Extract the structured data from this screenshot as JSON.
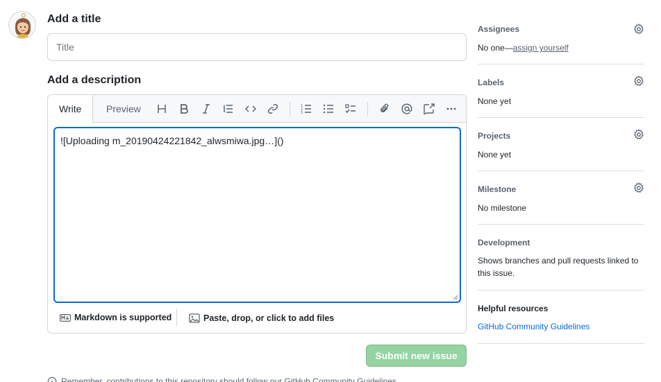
{
  "form": {
    "title_label": "Add a title",
    "title_placeholder": "Title",
    "description_label": "Add a description"
  },
  "editor": {
    "tabs": [
      {
        "label": "Write",
        "active": true
      },
      {
        "label": "Preview",
        "active": false
      }
    ],
    "toolbar_icons": [
      "heading-icon",
      "bold-icon",
      "italic-icon",
      "quote-icon",
      "code-icon",
      "link-icon",
      "ordered-list-icon",
      "unordered-list-icon",
      "task-list-icon",
      "attach-icon",
      "mention-icon",
      "reference-icon",
      "more-icon"
    ],
    "body_text": "![Uploading m_20190424221842_alwsmiwa.jpg…]()",
    "markdown_supported": "Markdown is supported",
    "paste_hint": "Paste, drop, or click to add files"
  },
  "actions": {
    "submit_label": "Submit new issue",
    "submit_color": "#94d3a2"
  },
  "bottom_note": "Remember, contributions to this repository should follow our GitHub Community Guidelines.",
  "sidebar": {
    "assignees": {
      "title": "Assignees",
      "prefix": "No one—",
      "link": "assign yourself"
    },
    "labels": {
      "title": "Labels",
      "value": "None yet"
    },
    "projects": {
      "title": "Projects",
      "value": "None yet"
    },
    "milestone": {
      "title": "Milestone",
      "value": "No milestone"
    },
    "development": {
      "title": "Development",
      "value": "Shows branches and pull requests linked to this issue."
    },
    "resources": {
      "title": "Helpful resources",
      "link": "GitHub Community Guidelines"
    }
  },
  "colors": {
    "accent": "#0969da",
    "border": "#d0d7de",
    "muted": "#59636e"
  }
}
